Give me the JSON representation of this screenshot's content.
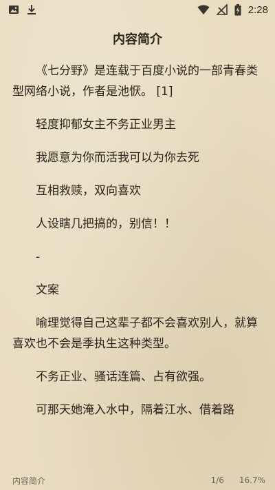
{
  "status_bar": {
    "time": "2:28",
    "left_icons": [
      "image-icon",
      "download-icon"
    ],
    "right_icons": [
      "wifi-icon",
      "no-signal-icon",
      "battery-charging-icon"
    ]
  },
  "page": {
    "title": "内容简介"
  },
  "content": {
    "paragraphs": [
      "《七分野》是连载于百度小说的一部青春类型网络小说，作者是池恹。 [1]",
      "轻度抑郁女主不务正业男主",
      "我愿意为你而活我可以为你去死",
      "互相救赎，双向喜欢",
      "人设瞎几把搞的，别信！！",
      "-",
      "文案",
      "喻理觉得自己这辈子都不会喜欢别人，就算喜欢也不会是季执生这种类型。",
      "不务正业、骚话连篇、占有欲强。",
      "可那天她淹入水中，隔着江水、借着路"
    ]
  },
  "footer": {
    "chapter": "内容简介",
    "page": "1/6",
    "progress": "16.7%"
  }
}
